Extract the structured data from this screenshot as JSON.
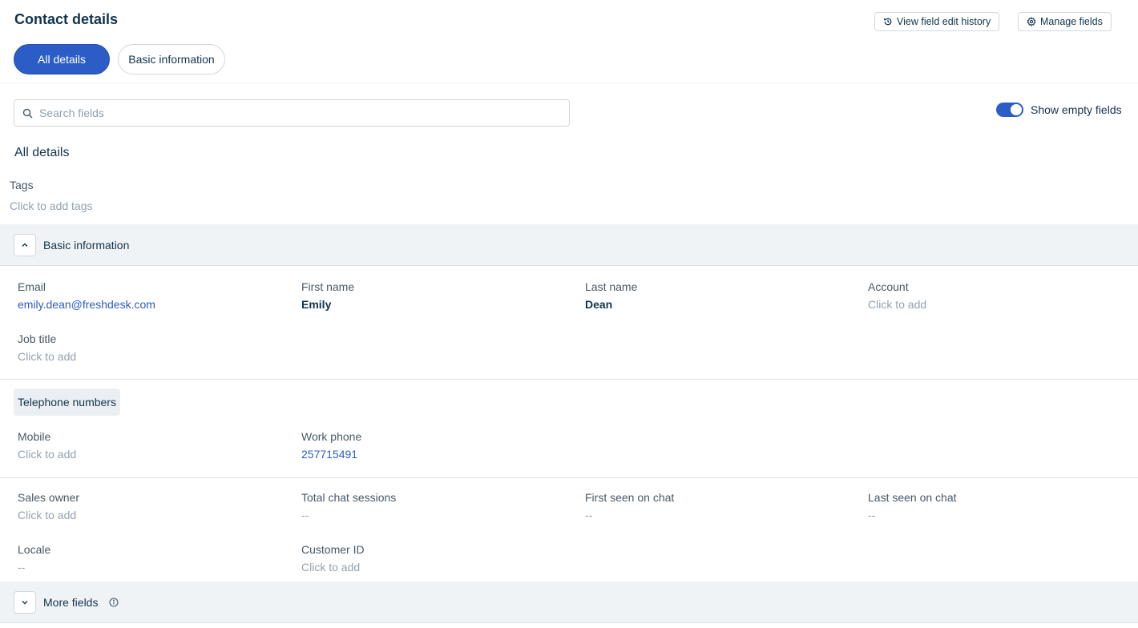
{
  "page": {
    "title": "Contact details",
    "history_button": "View field edit history",
    "manage_button": "Manage fields"
  },
  "tabs": [
    {
      "label": "All details",
      "active": true
    },
    {
      "label": "Basic information",
      "active": false
    }
  ],
  "search": {
    "placeholder": "Search fields",
    "value": ""
  },
  "toggle": {
    "label": "Show empty fields",
    "on": true
  },
  "section_title": "All details",
  "tags": {
    "label": "Tags",
    "action": "Click to add tags"
  },
  "basic": {
    "title": "Basic information",
    "fields": {
      "email": {
        "label": "Email",
        "value": "emily.dean@freshdesk.com"
      },
      "first_name": {
        "label": "First name",
        "value": "Emily"
      },
      "last_name": {
        "label": "Last name",
        "value": "Dean"
      },
      "account": {
        "label": "Account",
        "value": "Click to add"
      },
      "job_title": {
        "label": "Job title",
        "value": "Click to add"
      }
    }
  },
  "telephone": {
    "title": "Telephone numbers",
    "mobile": {
      "label": "Mobile",
      "value": "Click to add"
    },
    "work_phone": {
      "label": "Work phone",
      "value": "257715491"
    }
  },
  "other": {
    "sales_owner": {
      "label": "Sales owner",
      "value": "Click to add"
    },
    "total_chat": {
      "label": "Total chat sessions",
      "value": "--"
    },
    "first_seen": {
      "label": "First seen on chat",
      "value": "--"
    },
    "last_seen": {
      "label": "Last seen on chat",
      "value": "--"
    },
    "locale": {
      "label": "Locale",
      "value": "--"
    },
    "customer_id": {
      "label": "Customer ID",
      "value": "Click to add"
    }
  },
  "more": {
    "title": "More fields"
  },
  "colors": {
    "accent": "#2c5cc5",
    "text": "#12344d",
    "muted": "#92a2b1",
    "band": "#f0f3f6"
  },
  "icons": [
    "history-icon",
    "gear-icon",
    "search-icon",
    "chevron-up-icon",
    "chevron-down-icon",
    "info-icon"
  ]
}
